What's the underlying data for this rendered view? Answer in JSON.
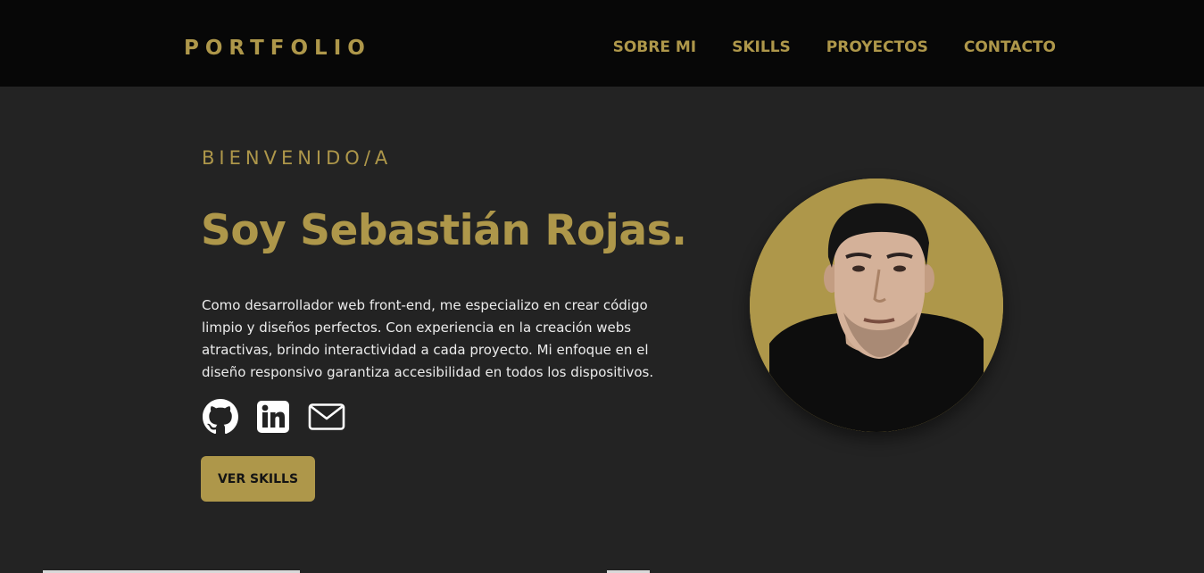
{
  "nav": {
    "brand": "PORTFOLIO",
    "links": [
      "SOBRE MI",
      "SKILLS",
      "PROYECTOS",
      "CONTACTO"
    ]
  },
  "hero": {
    "greeting": "BIENVENIDO/A",
    "title": "Soy Sebastián Rojas.",
    "description": "Como desarrollador web front-end, me especializo en crear código limpio y diseños perfectos. Con experiencia en la creación webs atractivas, brindo interactividad a cada proyecto. Mi enfoque en el diseño responsivo garantiza accesibilidad en todos los dispositivos.",
    "socials": [
      {
        "icon": "github-icon"
      },
      {
        "icon": "linkedin-icon"
      },
      {
        "icon": "mail-icon"
      }
    ],
    "cta_label": "VER SKILLS",
    "avatar": "profile-photo"
  },
  "colors": {
    "accent": "#ae974a",
    "background": "#232323",
    "navbar": "#070707",
    "text": "#ececec"
  }
}
